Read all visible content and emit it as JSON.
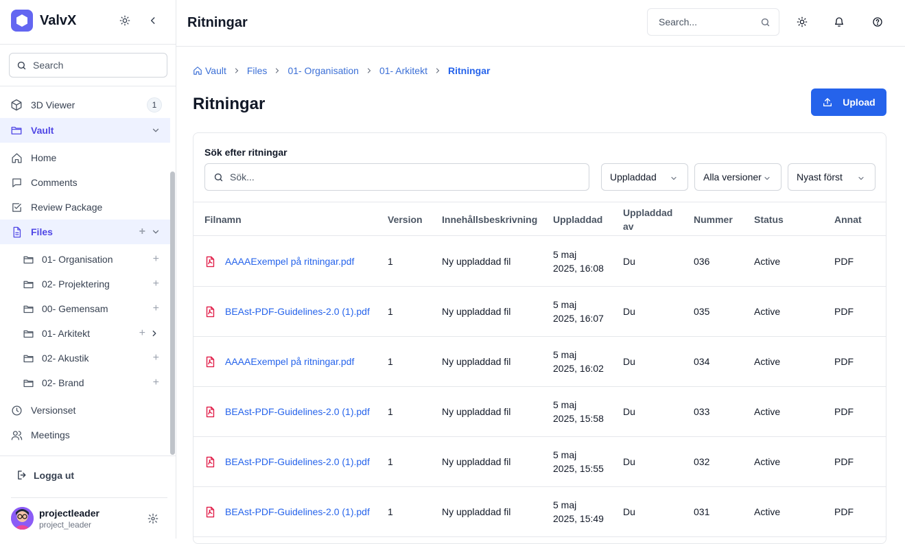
{
  "app": {
    "name": "ValvX"
  },
  "sidebar": {
    "search_placeholder": "Search",
    "items": [
      {
        "label": "3D Viewer",
        "badge": "1"
      },
      {
        "label": "Vault"
      },
      {
        "label": "Home"
      },
      {
        "label": "Comments"
      },
      {
        "label": "Review Package"
      },
      {
        "label": "Files"
      }
    ],
    "folders": [
      {
        "label": "01- Organisation"
      },
      {
        "label": "02- Projektering"
      },
      {
        "label": "00- Gemensam"
      },
      {
        "label": "01- Arkitekt"
      },
      {
        "label": "02- Akustik"
      },
      {
        "label": "02- Brand"
      }
    ],
    "bottom_items": [
      {
        "label": "Versionset"
      },
      {
        "label": "Meetings"
      }
    ],
    "logout": "Logga ut",
    "user": {
      "name": "projectleader",
      "role": "project_leader"
    }
  },
  "header": {
    "title": "Ritningar",
    "search_placeholder": "Search..."
  },
  "breadcrumb": [
    "Vault",
    "Files",
    "01- Organisation",
    "01- Arkitekt",
    "Ritningar"
  ],
  "page": {
    "title": "Ritningar",
    "upload_label": "Upload"
  },
  "filters": {
    "title": "Sök efter ritningar",
    "search_placeholder": "Sök...",
    "selects": [
      "Uppladdad",
      "Alla versioner",
      "Nyast först"
    ]
  },
  "table": {
    "columns": [
      "Filnamn",
      "Version",
      "Innehållsbeskrivning",
      "Uppladdad",
      "Uppladdad av",
      "Nummer",
      "Status",
      "Annat"
    ],
    "rows": [
      {
        "file": "AAAAExempel på ritningar.pdf",
        "version": "1",
        "desc": "Ny uppladdad fil",
        "date1": "5 maj",
        "date2": "2025, 16:08",
        "by": "Du",
        "num": "036",
        "status": "Active",
        "other": "PDF"
      },
      {
        "file": "BEAst-PDF-Guidelines-2.0 (1).pdf",
        "version": "1",
        "desc": "Ny uppladdad fil",
        "date1": "5 maj",
        "date2": "2025, 16:07",
        "by": "Du",
        "num": "035",
        "status": "Active",
        "other": "PDF"
      },
      {
        "file": "AAAAExempel på ritningar.pdf",
        "version": "1",
        "desc": "Ny uppladdad fil",
        "date1": "5 maj",
        "date2": "2025, 16:02",
        "by": "Du",
        "num": "034",
        "status": "Active",
        "other": "PDF"
      },
      {
        "file": "BEAst-PDF-Guidelines-2.0 (1).pdf",
        "version": "1",
        "desc": "Ny uppladdad fil",
        "date1": "5 maj",
        "date2": "2025, 15:58",
        "by": "Du",
        "num": "033",
        "status": "Active",
        "other": "PDF"
      },
      {
        "file": "BEAst-PDF-Guidelines-2.0 (1).pdf",
        "version": "1",
        "desc": "Ny uppladdad fil",
        "date1": "5 maj",
        "date2": "2025, 15:55",
        "by": "Du",
        "num": "032",
        "status": "Active",
        "other": "PDF"
      },
      {
        "file": "BEAst-PDF-Guidelines-2.0 (1).pdf",
        "version": "1",
        "desc": "Ny uppladdad fil",
        "date1": "5 maj",
        "date2": "2025, 15:49",
        "by": "Du",
        "num": "031",
        "status": "Active",
        "other": "PDF"
      }
    ]
  },
  "colors": {
    "accent": "#2563eb",
    "brand": "#6366f1",
    "pdf_icon": "#e11d48"
  }
}
